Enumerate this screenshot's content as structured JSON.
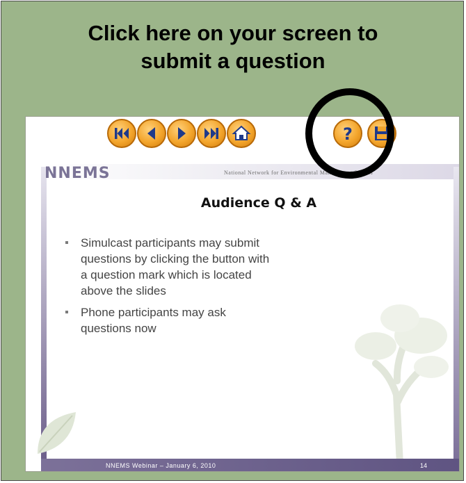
{
  "heading": {
    "line1": "Click here on your screen to",
    "line2": "submit a question"
  },
  "nav_buttons": [
    {
      "name": "first-slide-button",
      "icon": "skip-to-start-icon"
    },
    {
      "name": "previous-slide-button",
      "icon": "chevron-left-icon"
    },
    {
      "name": "next-slide-button",
      "icon": "chevron-right-icon"
    },
    {
      "name": "last-slide-button",
      "icon": "skip-to-end-icon"
    },
    {
      "name": "home-button",
      "icon": "home-icon"
    },
    {
      "name": "question-button",
      "icon": "question-mark-icon"
    },
    {
      "name": "save-button",
      "icon": "floppy-disk-icon"
    }
  ],
  "slide": {
    "logo": "NNEMS",
    "org_name": "National Network for Environmental Management Studies",
    "title": "Audience Q & A",
    "bullets": [
      "Simulcast participants may submit questions by clicking the button with a question mark which is located above the slides",
      "Phone participants may ask questions now"
    ],
    "footer": "NNEMS Webinar – January 6, 2010",
    "page_number": "14"
  },
  "colors": {
    "background": "#9cb58a",
    "button_orange": "#f3a52c",
    "button_icon_blue": "#1f3a8a",
    "slide_purple": "#6d5f8b"
  }
}
